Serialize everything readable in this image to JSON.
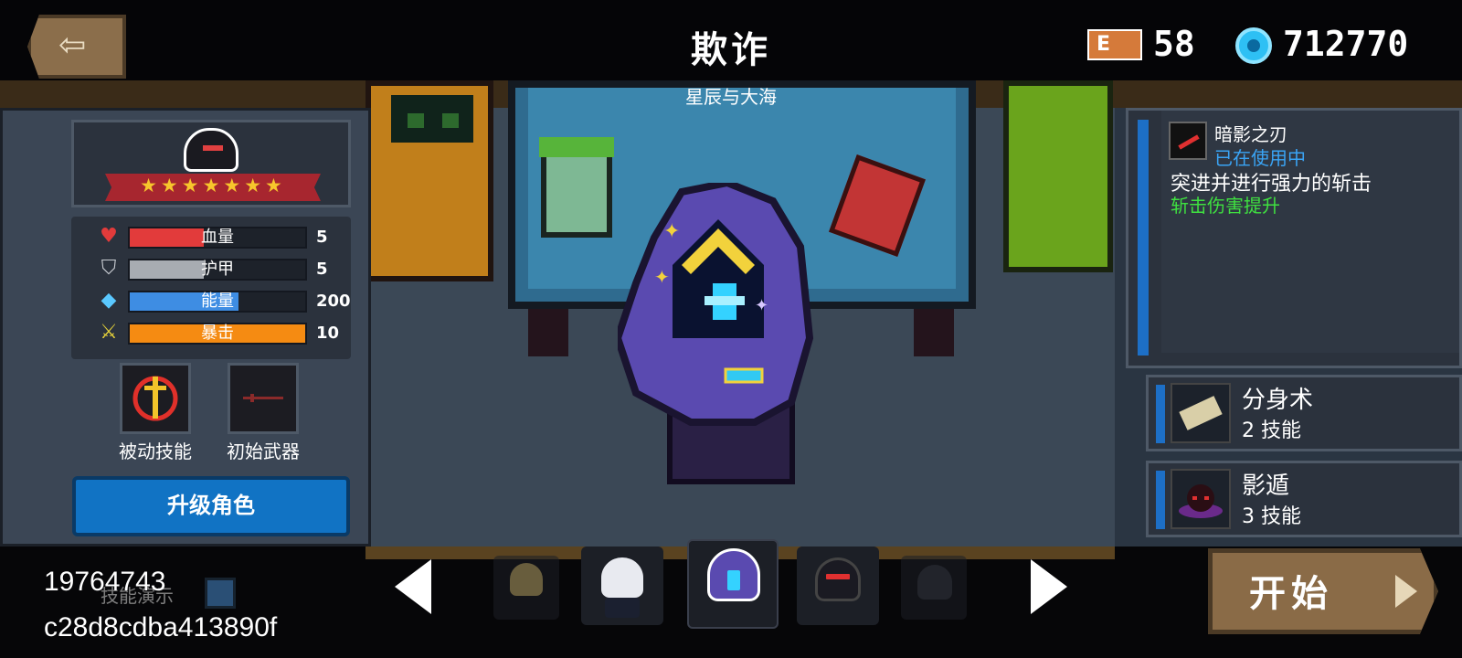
{
  "header": {
    "title": "欺诈",
    "subtitle": "星辰与大海",
    "exit_icon": "exit-door-icon",
    "currency": {
      "ep_badge": "E",
      "ep_value": "58",
      "gem_value": "712770"
    }
  },
  "stats": [
    {
      "label": "血量",
      "value": "5",
      "icon": "heart-icon",
      "color": "#e23b3b",
      "fill": 0.42
    },
    {
      "label": "护甲",
      "value": "5",
      "icon": "shield-icon",
      "color": "#a8acb2",
      "fill": 0.42
    },
    {
      "label": "能量",
      "value": "200",
      "icon": "crystal-icon",
      "color": "#3e8de3",
      "fill": 0.62
    },
    {
      "label": "暴击",
      "value": "10",
      "icon": "sword-icon",
      "color": "#f58b12",
      "fill": 1.0
    }
  ],
  "portrait": {
    "stars": "★★★★★★★"
  },
  "slots": {
    "passive_label": "被动技能",
    "weapon_label": "初始武器"
  },
  "upgrade_label": "升级角色",
  "weapon_panel": {
    "name": "暗影之刃",
    "status": "已在使用中",
    "description": "突进并进行强力的斩击",
    "bonus": "斩击伤害提升"
  },
  "skills": [
    {
      "name": "分身术",
      "sub": "2 技能",
      "icon": "scroll-icon"
    },
    {
      "name": "影遁",
      "sub": "3 技能",
      "icon": "shadow-icon"
    }
  ],
  "skill_demo_label": "技能演示",
  "start_label": "开始",
  "overlay": {
    "line1": "19764743",
    "line2": "c28d8cdba413890f"
  },
  "colors": {
    "accent_blue": "#1173c4",
    "gold": "#f7c62c",
    "bonus_green": "#3fe040",
    "status_blue": "#3aa4f5"
  }
}
